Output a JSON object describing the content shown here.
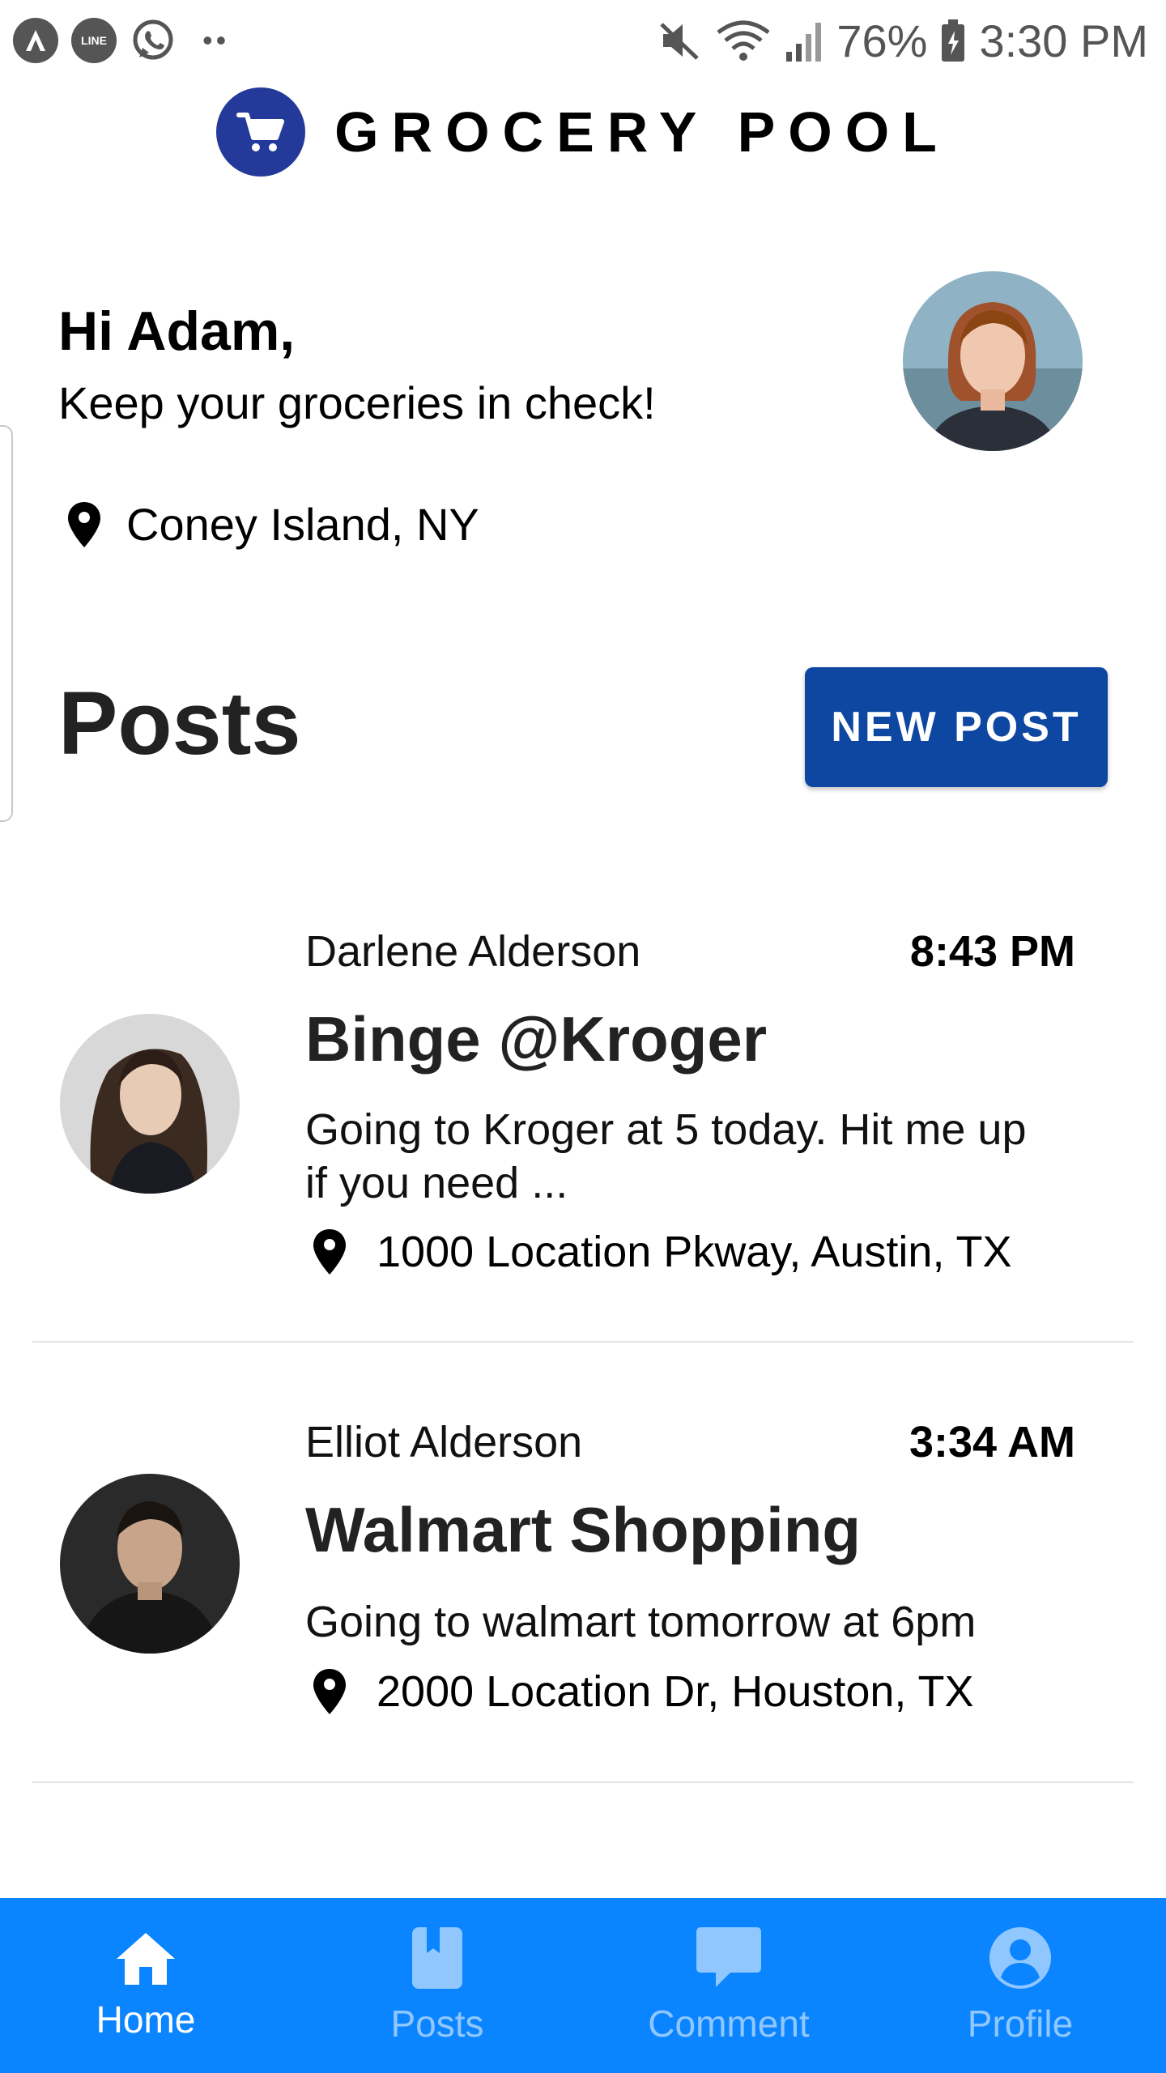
{
  "status_bar": {
    "left_icons": [
      "a-icon",
      "line-icon",
      "whatsapp-icon"
    ],
    "battery": "76%",
    "time": "3:30 PM"
  },
  "header": {
    "title": "GROCERY POOL",
    "logo_icon": "cart-icon",
    "brand_color": "#243a9a"
  },
  "greeting": {
    "title": "Hi Adam,",
    "subtitle": "Keep your groceries in check!",
    "location": "Coney Island, NY"
  },
  "posts_section": {
    "heading": "Posts",
    "new_post_label": "NEW POST",
    "button_color": "#0d47a1"
  },
  "posts": [
    {
      "author": "Darlene Alderson",
      "time": "8:43 PM",
      "title": "Binge @Kroger",
      "body": "Going to Kroger at 5 today. Hit me up if you need ...",
      "location": "1000 Location Pkway, Austin, TX"
    },
    {
      "author": "Elliot Alderson",
      "time": "3:34 AM",
      "title": "Walmart Shopping",
      "body": "Going to walmart tomorrow at 6pm",
      "location": "2000 Location Dr, Houston, TX"
    }
  ],
  "bottom_nav": {
    "background": "#0a84ff",
    "items": [
      {
        "label": "Home",
        "icon": "home-icon",
        "active": true
      },
      {
        "label": "Posts",
        "icon": "bookmark-icon",
        "active": false
      },
      {
        "label": "Comment",
        "icon": "comment-icon",
        "active": false
      },
      {
        "label": "Profile",
        "icon": "profile-icon",
        "active": false
      }
    ]
  }
}
